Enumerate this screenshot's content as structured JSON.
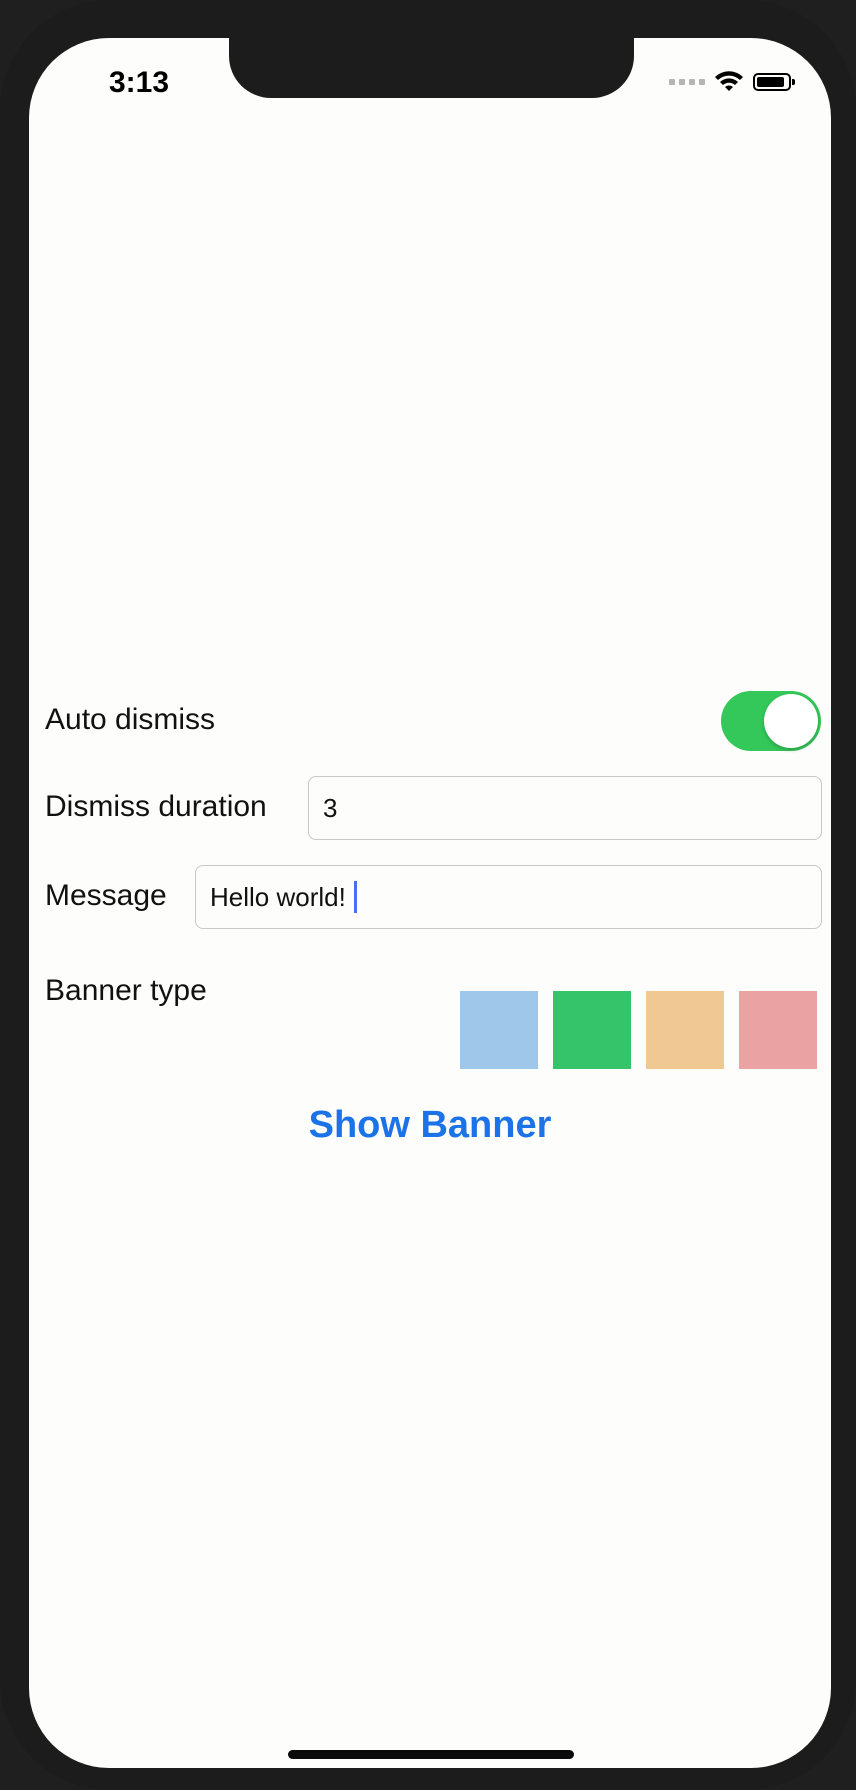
{
  "status_bar": {
    "time": "3:13",
    "icons": [
      "cellular-signal-icon",
      "wifi-icon",
      "battery-icon"
    ]
  },
  "form": {
    "auto_dismiss": {
      "label": "Auto dismiss",
      "enabled": true,
      "toggle_color": "#34c759"
    },
    "dismiss_duration": {
      "label": "Dismiss duration",
      "value": "3"
    },
    "message": {
      "label": "Message",
      "value": "Hello world!"
    },
    "banner_type": {
      "label": "Banner type",
      "options": [
        {
          "name": "info",
          "color": "#9fc7ea"
        },
        {
          "name": "success",
          "color": "#35c46a"
        },
        {
          "name": "warning",
          "color": "#f0c894"
        },
        {
          "name": "danger",
          "color": "#eba2a2"
        }
      ]
    }
  },
  "actions": {
    "show_banner": "Show Banner",
    "accent_color": "#1c73e8"
  }
}
